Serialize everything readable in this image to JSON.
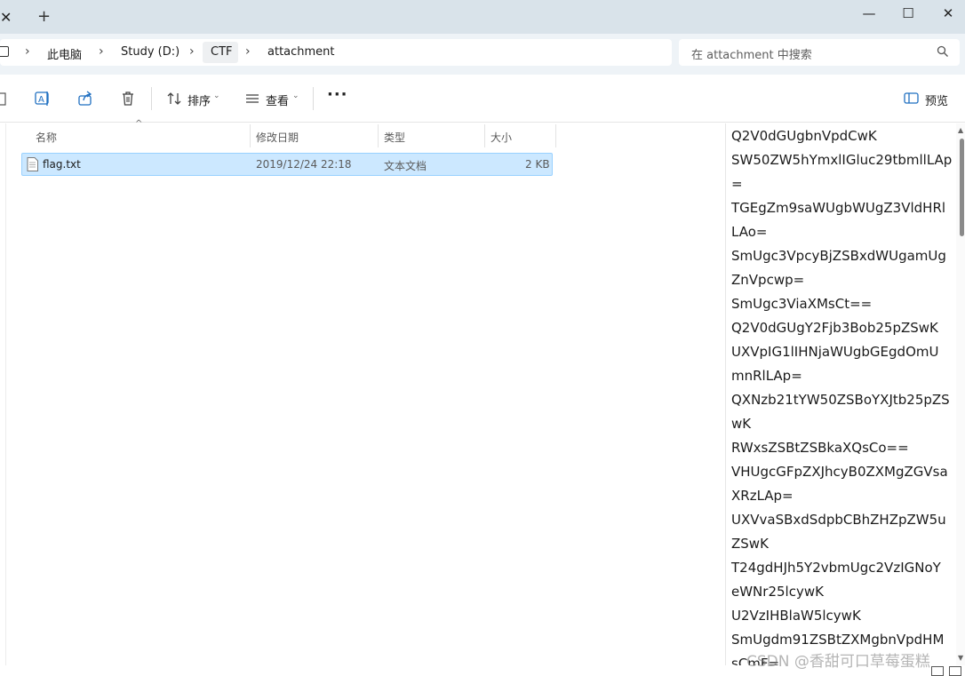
{
  "titlebar": {
    "tab_close_glyph": "✕",
    "new_tab_glyph": "+",
    "minimize_glyph": "—",
    "maximize_glyph": "☐",
    "close_glyph": "✕"
  },
  "address": {
    "crumbs": [
      "此电脑",
      "Study (D:)",
      "CTF",
      "attachment"
    ],
    "chevron": "›"
  },
  "search": {
    "placeholder": "在 attachment 中搜索"
  },
  "toolbar": {
    "sort_label": "排序",
    "view_label": "查看",
    "more_glyph": "···",
    "preview_label": "预览",
    "caret": "⌄"
  },
  "file_list": {
    "columns": [
      "名称",
      "修改日期",
      "类型",
      "大小"
    ],
    "sort_glyph": "^",
    "rows": [
      {
        "name": "flag.txt",
        "modified": "2019/12/24 22:18",
        "type": "文本文档",
        "size": "2 KB"
      }
    ]
  },
  "preview": {
    "lines": [
      "Q2V0dGUgbnVpdCwK",
      "SW50ZW5hYmxlIGluc29tbmllLAp",
      "=",
      "TGEgZm9saWUgbWUgZ3VldHRl",
      "LAo=",
      "SmUgc3VpcyBjZSBxdWUgamUg",
      "ZnVpcwp=",
      "SmUgc3ViaXMsCt==",
      "Q2V0dGUgY2Fjb3Bob25pZSwK",
      "UXVpIG1lIHNjaWUgbGEgdOmU",
      "mnRlLAp=",
      "QXNzb21tYW50ZSBoYXJtb25pZS",
      "wK",
      "RWxsZSBtZSBkaXQsCo==",
      "VHUgcGFpZXJhcyB0ZXMgZGVsa",
      "XRzLAp=",
      "UXVvaSBxdSdpbCBhZHZpZW5u",
      "ZSwK",
      "T24gdHJh5Y2vbmUgc2VzIGNoY",
      "eWNr25lcywK",
      "U2VzIHBlaW5lcywK",
      "SmUgdm91ZSBtZXMgbnVpdHM",
      "sCmF="
    ]
  },
  "scroll": {
    "up_glyph": "▲",
    "down_glyph": "▼"
  },
  "watermark": "CSDN @香甜可口草莓蛋糕"
}
